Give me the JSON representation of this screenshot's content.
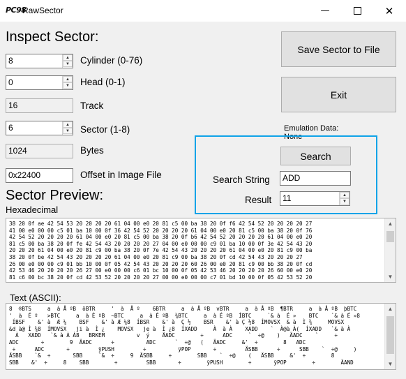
{
  "window": {
    "icon_text": "PC98",
    "title": "RawSector",
    "min_glyph": "—",
    "close_glyph": "✕"
  },
  "inspect": {
    "heading": "Inspect Sector:",
    "cylinder": {
      "value": "8",
      "label": "Cylinder (0-76)"
    },
    "head": {
      "value": "0",
      "label": "Head (0-1)"
    },
    "track": {
      "value": "16",
      "label": "Track"
    },
    "sector": {
      "value": "6",
      "label": "Sector (1-8)"
    },
    "bytes": {
      "value": "1024",
      "label": "Bytes"
    },
    "offset": {
      "value": "0x22400",
      "label": "Offset in Image File"
    }
  },
  "actions": {
    "save_label": "Save Sector to File",
    "exit_label": "Exit"
  },
  "emulation": {
    "label": "Emulation Data:",
    "value": "None"
  },
  "search": {
    "button_label": "Search",
    "string_label": "Search String",
    "string_value": "ADD",
    "result_label": "Result",
    "result_value": "11"
  },
  "preview": {
    "heading": "Sector Preview:",
    "hex_label": "Hexadecimal",
    "hex_text": "38 20 0f ae 42 54 53 20 20 20 20 61 04 00 e0 20 81 c5 00 ba 38 20 0f f6 42 54 52 20 20 20 20 27\n41 00 e0 00 00 c5 01 ba 10 00 0f 36 42 54 52 20 20 20 20 61 04 00 e0 20 81 c5 00 ba 38 20 0f 76\n42 54 52 20 20 20 20 61 04 00 e0 20 81 c5 00 ba 38 20 0f b6 42 54 52 20 20 20 20 61 04 00 e0 20\n81 c5 00 ba 38 20 0f fe 42 54 43 20 20 20 20 27 04 00 e0 00 00 c9 01 ba 10 00 0f 3e 42 54 43 20\n20 20 20 61 04 00 e0 20 81 c9 00 ba 38 20 0f 7e 42 54 43 20 20 20 20 61 04 00 e0 20 81 c9 00 ba\n38 20 0f be 42 54 43 20 20 20 20 61 04 00 e0 20 81 c9 00 ba 38 20 0f cd 42 54 43 20 20 20 27\n26 00 e0 00 00 c9 01 bb 10 00 0f 05 42 54 43 20 20 20 20 60 26 00 e0 20 81 c9 00 bb 38 20 0f cd\n42 53 46 20 20 20 20 26 27 00 e0 00 00 c6 01 bc 10 00 0f 05 42 53 46 20 20 20 20 26 60 00 e0 20\n81 c6 00 bc 38 20 0f cd 42 53 52 20 20 20 20 27 00 00 e0 00 00 c7 01 bd 10 00 0f 05 42 53 52 20",
    "ascii_label": "Text (ASCII):",
    "ascii_text": "8  ®BTS     a  à Å ºB  öBTR     '  à  Å º    6BTR     a  à Å ºB  vBTR     a  à Å ºB  ¶BTR     a  à Å ºB  þBTC\n'  à  É º   >BTC     a  à É ºB  ~BTC     a  à É ºB  ¾BTC     a  à É ºB  ÍBTC     `& à  É »    BTC    `& à É »8\n ÍBSF    &' à  Æ ¼    BSF    &' à Æ ¼8  ÍBSR    &' à  Ç ½    BSR    &' à Ç ½8  ÍMOVSX  & à  Ì ¾     MOVSX\n&d à@ Ì ¾8  ÍMOVSX   ji à  Ì ¿    MOVSX   je à  Ì ¿8  ÍXADD     À  à À    XADD    `  À@à À(  ÍXADD   `& à À\n  À   XADD   `& à À À8   BRKEM          v  ý    ÄADC        ÷      ADC     `  ÷@    )   ÄADC    `     ÷\nADC       ÷        9  ÄADC      ÷          ADC      `  ÷@   (   ÄADC     &'  ÷        8   ADC\n ÷      ADC       ÷         ÿPUSH         ÷          ÿPOP       ÷         ÄSBB      ÷      SBB    `  ÷@     )\nÄSBB    `&  ÷       SBB     `&  ÷     9  ÄSBB     ÷        SBB    `  ÷@    (   ÄSBB     &'  ÷        8\nSBB    &'  ÷     8    SBB        ÷         SBB       ÷        ÿPUSH        ÷       ÿPOP        ÷        ÄAND"
  }
}
